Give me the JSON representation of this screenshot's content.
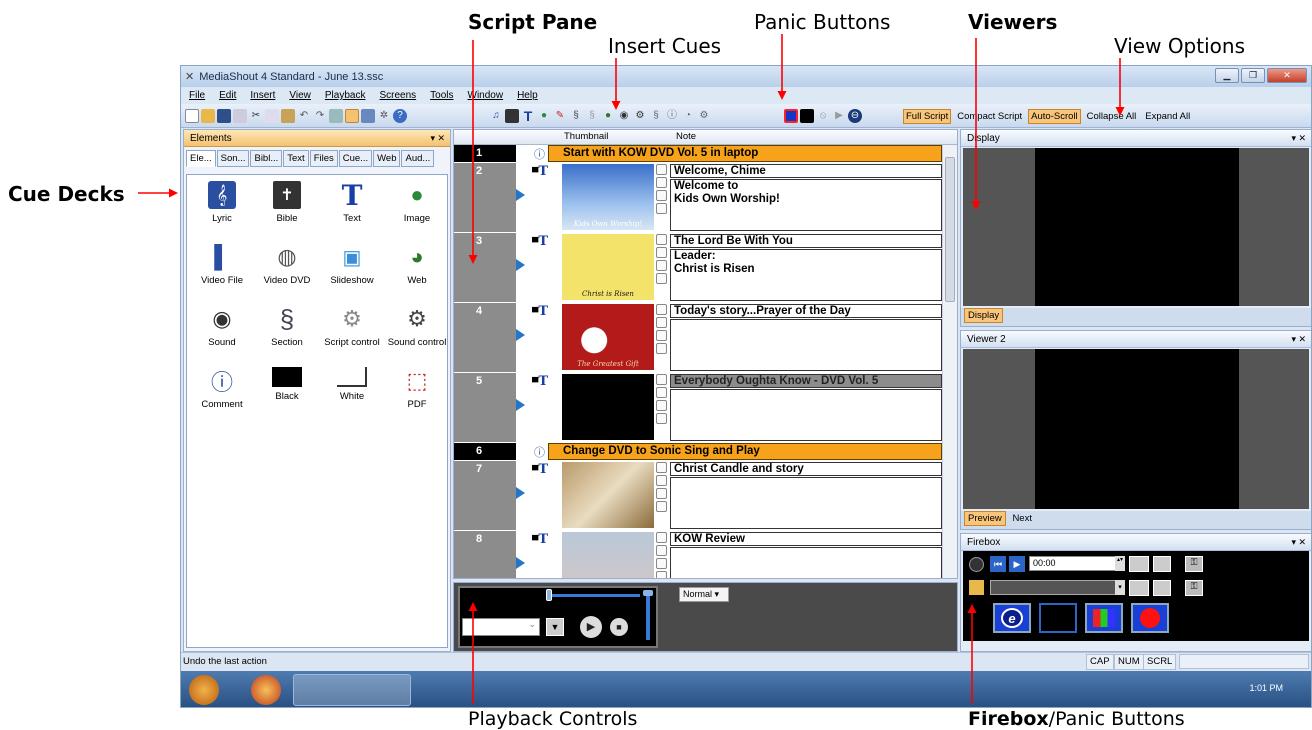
{
  "annotations": {
    "script_pane": "Script Pane",
    "insert_cues": "Insert Cues",
    "panic_buttons": "Panic Buttons",
    "viewers": "Viewers",
    "view_options": "View Options",
    "cue_decks": "Cue Decks",
    "playback_controls": "Playback Controls",
    "firebox_bold": "Firebox",
    "firebox_rest": "/Panic Buttons"
  },
  "window": {
    "title": "MediaShout 4 Standard - June 13.ssc",
    "menu": [
      "File",
      "Edit",
      "Insert",
      "View",
      "Playback",
      "Screens",
      "Tools",
      "Window",
      "Help"
    ]
  },
  "view_options": {
    "full_script": "Full Script",
    "compact_script": "Compact Script",
    "auto_scroll": "Auto-Scroll",
    "collapse_all": "Collapse All",
    "expand_all": "Expand All"
  },
  "elements_pane": {
    "title": "Elements",
    "tabs": [
      "Ele...",
      "Son...",
      "Bibl...",
      "Text",
      "Files",
      "Cue...",
      "Web",
      "Aud..."
    ],
    "items": [
      {
        "label": "Lyric",
        "icon": "lyric-icon"
      },
      {
        "label": "Bible",
        "icon": "bible-icon"
      },
      {
        "label": "Text",
        "icon": "text-icon"
      },
      {
        "label": "Image",
        "icon": "image-icon"
      },
      {
        "label": "Video File",
        "icon": "video-file-icon"
      },
      {
        "label": "Video DVD",
        "icon": "video-dvd-icon"
      },
      {
        "label": "Slideshow",
        "icon": "slideshow-icon"
      },
      {
        "label": "Web",
        "icon": "web-icon"
      },
      {
        "label": "Sound",
        "icon": "sound-icon"
      },
      {
        "label": "Section",
        "icon": "section-icon"
      },
      {
        "label": "Script control",
        "icon": "script-control-icon"
      },
      {
        "label": "Sound control",
        "icon": "sound-control-icon"
      },
      {
        "label": "Comment",
        "icon": "comment-icon"
      },
      {
        "label": "Black",
        "icon": "black-icon"
      },
      {
        "label": "White",
        "icon": "white-icon"
      },
      {
        "label": "PDF",
        "icon": "pdf-icon"
      }
    ]
  },
  "script_pane": {
    "col_thumbnail": "Thumbnail",
    "col_note": "Note",
    "rows": [
      {
        "num": "1",
        "header": true,
        "title": "Start with KOW DVD Vol. 5 in laptop"
      },
      {
        "num": "2",
        "title": "Welcome, Chime",
        "body": [
          "Welcome to",
          "Kids Own Worship!"
        ],
        "thumb_text": "Kids Own Worship!",
        "thumb": "sky"
      },
      {
        "num": "3",
        "title": "The Lord Be With You",
        "body": [
          "Leader:",
          "Christ is Risen"
        ],
        "thumb_text": "Christ is Risen",
        "thumb": "cross"
      },
      {
        "num": "4",
        "title": "Today's story...Prayer of the Day",
        "body": [],
        "thumb_text": "The Greatest Gift",
        "thumb": "gift"
      },
      {
        "num": "5",
        "title": "Everybody Oughta Know - DVD Vol. 5",
        "body": [],
        "thumb_text": "",
        "thumb": "black",
        "gray": true
      },
      {
        "num": "6",
        "header": true,
        "title": "Change DVD to Sonic Sing and Play"
      },
      {
        "num": "7",
        "title": "Christ Candle and story",
        "body": [],
        "thumb_text": "",
        "thumb": "book"
      },
      {
        "num": "8",
        "title": "KOW Review",
        "body": [],
        "thumb_text": "",
        "thumb": "tree"
      }
    ]
  },
  "playback": {
    "blend_mode": "Normal"
  },
  "viewers": {
    "display_title": "Display",
    "display_tab": "Display",
    "viewer2_title": "Viewer 2",
    "viewer2_tabs": [
      "Preview",
      "Next"
    ]
  },
  "firebox": {
    "title": "Firebox",
    "time": "00:00"
  },
  "status": {
    "text": "Undo the last action",
    "cap": "CAP",
    "num": "NUM",
    "scrl": "SCRL"
  },
  "taskbar": {
    "clock": "1:01 PM"
  },
  "colors": {
    "cue_header": "#f7a21b",
    "annotation_arrow": "#ff0000",
    "active_tab": "#f9c57a"
  }
}
